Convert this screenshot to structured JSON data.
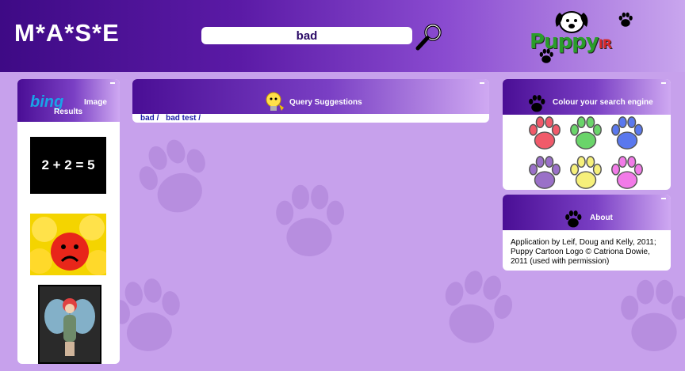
{
  "header": {
    "site_title": "M*A*S*E",
    "search_value": "bad",
    "logo_text": "Puppy",
    "logo_suffix": "IR"
  },
  "image_results": {
    "brand": "bing",
    "title_line1": "Image",
    "title_line2": "Results",
    "thumbs": [
      {
        "icon": "math-equation-image",
        "text": "2 + 2 = 5"
      },
      {
        "icon": "sad-smiley-image"
      },
      {
        "icon": "fairy-image"
      }
    ]
  },
  "query_suggestions": {
    "title": "Query Suggestions",
    "links": [
      {
        "label": "bad",
        "sep": "/"
      },
      {
        "label": "bad test",
        "sep": "/"
      }
    ]
  },
  "colour_panel": {
    "title": "Colour your search engine",
    "paws": [
      {
        "name": "red",
        "color": "#f05a6a"
      },
      {
        "name": "green",
        "color": "#6ad46a"
      },
      {
        "name": "blue",
        "color": "#5a78ee"
      },
      {
        "name": "purple",
        "color": "#9a70c8"
      },
      {
        "name": "yellow",
        "color": "#f6f07a"
      },
      {
        "name": "pink",
        "color": "#f27ae8"
      }
    ]
  },
  "about": {
    "title": "About",
    "text": "Application by Leif, Doug and Kelly, 2011; Puppy Cartoon Logo © Catriona Dowie, 2011 (used with permission)"
  },
  "colors": {
    "header_dark": "#3e0a85",
    "page_bg": "#c7a1ec",
    "link": "#1a1aa8"
  }
}
